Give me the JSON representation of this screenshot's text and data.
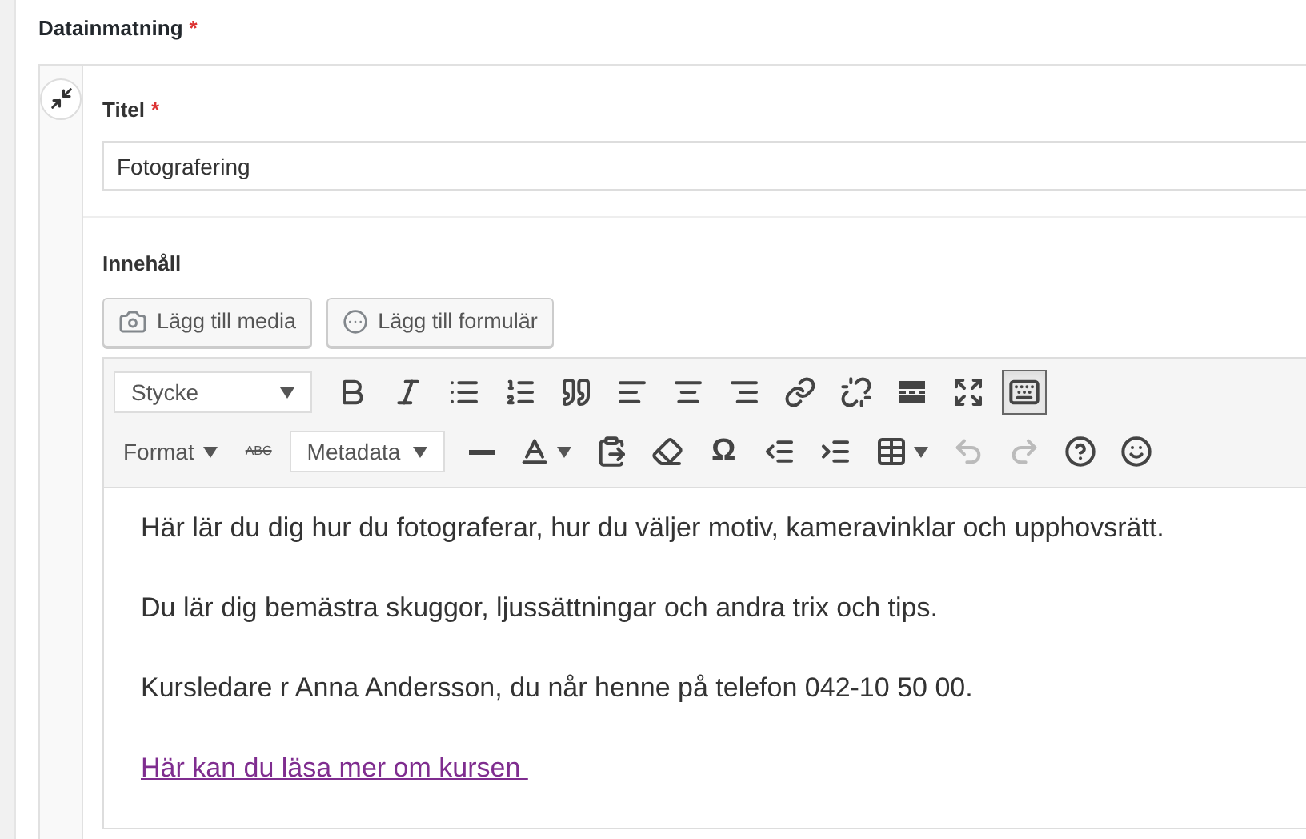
{
  "section": {
    "label": "Datainmatning",
    "required_mark": "*"
  },
  "title_field": {
    "label": "Titel",
    "required_mark": "*",
    "value": "Fotografering"
  },
  "content": {
    "label": "Innehåll",
    "media_buttons": [
      {
        "label": "Lägg till media"
      },
      {
        "label": "Lägg till formulär"
      }
    ],
    "toolbar_rows": [
      [
        {
          "kind": "select",
          "label": "Stycke"
        },
        {
          "kind": "button",
          "active": false,
          "disabled": false
        },
        {
          "kind": "button",
          "active": false,
          "disabled": false
        },
        {
          "kind": "button",
          "active": false,
          "disabled": false
        },
        {
          "kind": "button",
          "active": false,
          "disabled": false
        },
        {
          "kind": "button",
          "active": false,
          "disabled": false
        },
        {
          "kind": "button",
          "active": false,
          "disabled": false
        },
        {
          "kind": "button",
          "active": false,
          "disabled": false
        },
        {
          "kind": "button",
          "active": false,
          "disabled": false
        },
        {
          "kind": "button",
          "active": false,
          "disabled": false
        },
        {
          "kind": "button",
          "active": false,
          "disabled": false
        },
        {
          "kind": "button",
          "active": false,
          "disabled": false
        },
        {
          "kind": "button",
          "active": false,
          "disabled": false
        },
        {
          "kind": "button",
          "active": true,
          "disabled": false
        }
      ],
      [
        {
          "kind": "menu",
          "label": "Format"
        },
        {
          "kind": "strike-text",
          "label": "ABC"
        },
        {
          "kind": "select",
          "label": "Metadata"
        },
        {
          "kind": "button",
          "active": false,
          "disabled": false
        },
        {
          "kind": "split",
          "active": false,
          "disabled": false
        },
        {
          "kind": "button",
          "active": false,
          "disabled": false
        },
        {
          "kind": "button",
          "active": false,
          "disabled": false
        },
        {
          "kind": "char",
          "label": "Ω"
        },
        {
          "kind": "button",
          "active": false,
          "disabled": false
        },
        {
          "kind": "button",
          "active": false,
          "disabled": false
        },
        {
          "kind": "split",
          "active": false,
          "disabled": false
        },
        {
          "kind": "button",
          "active": false,
          "disabled": true
        },
        {
          "kind": "button",
          "active": false,
          "disabled": true
        },
        {
          "kind": "button",
          "active": false,
          "disabled": false
        },
        {
          "kind": "button",
          "active": false,
          "disabled": false
        }
      ]
    ],
    "paragraphs": [
      {
        "kind": "text",
        "text": "Här lär du dig hur du fotograferar, hur du väljer motiv, kameravinklar och upphovsrätt."
      },
      {
        "kind": "text",
        "text": "Du lär dig bemästra skuggor, ljussättningar och andra trix och tips."
      },
      {
        "kind": "text",
        "text": "Kursledare r Anna Andersson, du når henne på telefon 042-10 50 00."
      },
      {
        "kind": "link",
        "text": "Här kan du läsa mer om kursen "
      }
    ]
  }
}
